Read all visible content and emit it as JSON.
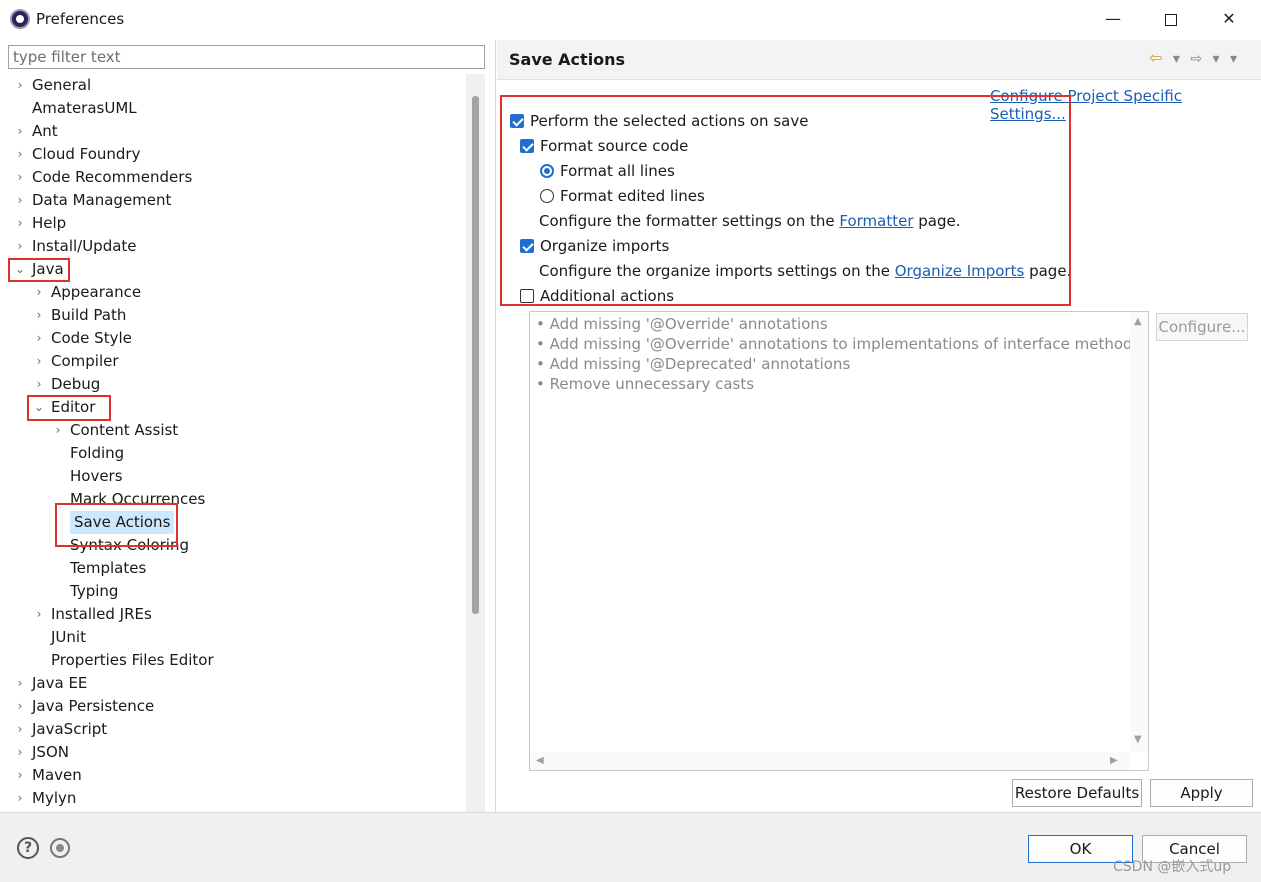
{
  "window": {
    "title": "Preferences",
    "minimize": "—",
    "close": "✕"
  },
  "filter": {
    "placeholder": "type filter text"
  },
  "tree": [
    {
      "label": "General",
      "chevron": "›",
      "indent": 0
    },
    {
      "label": "AmaterasUML",
      "chevron": "",
      "indent": 0
    },
    {
      "label": "Ant",
      "chevron": "›",
      "indent": 0
    },
    {
      "label": "Cloud Foundry",
      "chevron": "›",
      "indent": 0
    },
    {
      "label": "Code Recommenders",
      "chevron": "›",
      "indent": 0
    },
    {
      "label": "Data Management",
      "chevron": "›",
      "indent": 0
    },
    {
      "label": "Help",
      "chevron": "›",
      "indent": 0
    },
    {
      "label": "Install/Update",
      "chevron": "›",
      "indent": 0
    },
    {
      "label": "Java",
      "chevron": "⌄",
      "indent": 0
    },
    {
      "label": "Appearance",
      "chevron": "›",
      "indent": 1
    },
    {
      "label": "Build Path",
      "chevron": "›",
      "indent": 1
    },
    {
      "label": "Code Style",
      "chevron": "›",
      "indent": 1
    },
    {
      "label": "Compiler",
      "chevron": "›",
      "indent": 1
    },
    {
      "label": "Debug",
      "chevron": "›",
      "indent": 1
    },
    {
      "label": "Editor",
      "chevron": "⌄",
      "indent": 1
    },
    {
      "label": "Content Assist",
      "chevron": "›",
      "indent": 2
    },
    {
      "label": "Folding",
      "chevron": "",
      "indent": 2
    },
    {
      "label": "Hovers",
      "chevron": "",
      "indent": 2
    },
    {
      "label": "Mark Occurrences",
      "chevron": "",
      "indent": 2
    },
    {
      "label": "Save Actions",
      "chevron": "",
      "indent": 2,
      "selected": true
    },
    {
      "label": "Syntax Coloring",
      "chevron": "",
      "indent": 2
    },
    {
      "label": "Templates",
      "chevron": "",
      "indent": 2
    },
    {
      "label": "Typing",
      "chevron": "",
      "indent": 2
    },
    {
      "label": "Installed JREs",
      "chevron": "›",
      "indent": 1
    },
    {
      "label": "JUnit",
      "chevron": "",
      "indent": 1
    },
    {
      "label": "Properties Files Editor",
      "chevron": "",
      "indent": 1
    },
    {
      "label": "Java EE",
      "chevron": "›",
      "indent": 0
    },
    {
      "label": "Java Persistence",
      "chevron": "›",
      "indent": 0
    },
    {
      "label": "JavaScript",
      "chevron": "›",
      "indent": 0
    },
    {
      "label": "JSON",
      "chevron": "›",
      "indent": 0
    },
    {
      "label": "Maven",
      "chevron": "›",
      "indent": 0
    },
    {
      "label": "Mylyn",
      "chevron": "›",
      "indent": 0
    }
  ],
  "page": {
    "title": "Save Actions",
    "nav_back": "⇦",
    "nav_forward": "⇨",
    "nav_menu": "▾",
    "project_link": "Configure Project Specific Settings...",
    "perform_on_save": "Perform the selected actions on save",
    "format_source": "Format source code",
    "format_all": "Format all lines",
    "format_edited": "Format edited lines",
    "formatter_pre": "Configure the formatter settings on the ",
    "formatter_link": "Formatter",
    "formatter_post": " page.",
    "organize_imports": "Organize imports",
    "organize_pre": "Configure the organize imports settings on the ",
    "organize_link": "Organize Imports",
    "organize_post": " page.",
    "additional_actions": "Additional actions",
    "additional_list": [
      "• Add missing '@Override' annotations",
      "• Add missing '@Override' annotations to implementations of interface methods",
      "• Add missing '@Deprecated' annotations",
      "• Remove unnecessary casts"
    ],
    "configure_button": "Configure...",
    "restore_button": "Restore Defaults",
    "apply_button": "Apply"
  },
  "footer": {
    "help": "?",
    "ok_button": "OK",
    "cancel_button": "Cancel",
    "watermark": "CSDN @嵌入式up"
  },
  "colors": {
    "highlight_box": "#e0302f",
    "selection": "#cce8ff",
    "link": "#1a5fb4",
    "check": "#1f6fd1"
  }
}
